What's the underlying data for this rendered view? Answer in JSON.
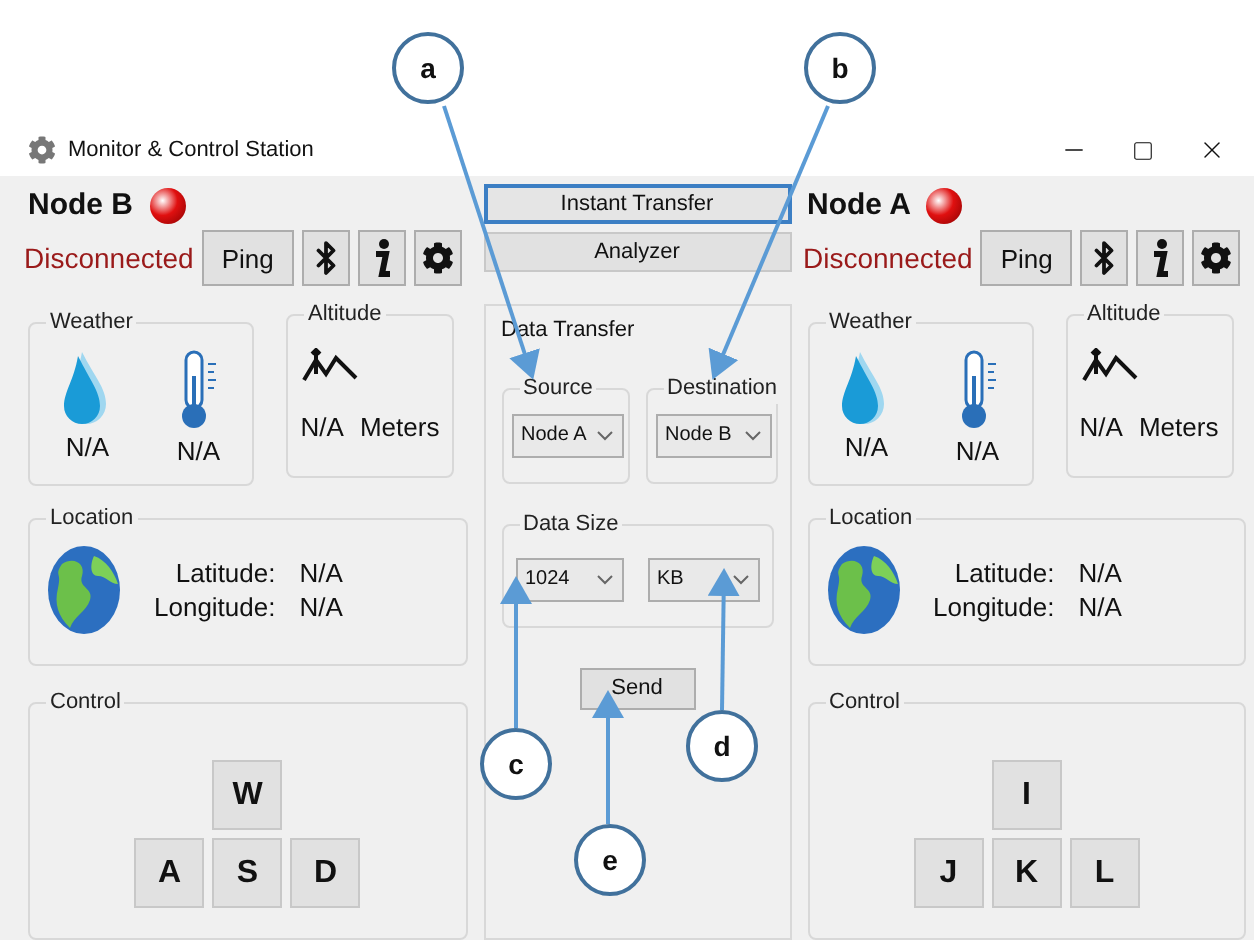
{
  "window": {
    "title": "Monitor & Control Station"
  },
  "nodes": [
    {
      "name": "Node B",
      "connected": false,
      "status": "Disconnected",
      "ping_label": "Ping",
      "weather": {
        "title": "Weather",
        "humidity": "N/A",
        "temperature": "N/A"
      },
      "altitude": {
        "title": "Altitude",
        "value": "N/A",
        "unit": "Meters"
      },
      "location": {
        "title": "Location",
        "latitude_label": "Latitude:",
        "latitude": "N/A",
        "longitude_label": "Longitude:",
        "longitude": "N/A"
      },
      "control": {
        "title": "Control",
        "key_rows": [
          [
            "W"
          ],
          [
            "A",
            "S",
            "D"
          ]
        ]
      }
    },
    {
      "name": "Node A",
      "connected": false,
      "status": "Disconnected",
      "ping_label": "Ping",
      "weather": {
        "title": "Weather",
        "humidity": "N/A",
        "temperature": "N/A"
      },
      "altitude": {
        "title": "Altitude",
        "value": "N/A",
        "unit": "Meters"
      },
      "location": {
        "title": "Location",
        "latitude_label": "Latitude:",
        "latitude": "N/A",
        "longitude_label": "Longitude:",
        "longitude": "N/A"
      },
      "control": {
        "title": "Control",
        "key_rows": [
          [
            "I"
          ],
          [
            "J",
            "K",
            "L"
          ]
        ]
      }
    }
  ],
  "tabs": [
    {
      "label": "Instant Transfer",
      "selected": true
    },
    {
      "label": "Analyzer",
      "selected": false
    }
  ],
  "data_transfer": {
    "title": "Data Transfer",
    "source": {
      "label": "Source",
      "value": "Node A"
    },
    "destination": {
      "label": "Destination",
      "value": "Node B"
    },
    "data_size": {
      "title": "Data Size",
      "amount": "1024",
      "unit": "KB"
    },
    "send_label": "Send"
  },
  "annotations": [
    {
      "label": "a"
    },
    {
      "label": "b"
    },
    {
      "label": "c"
    },
    {
      "label": "d"
    },
    {
      "label": "e"
    }
  ]
}
